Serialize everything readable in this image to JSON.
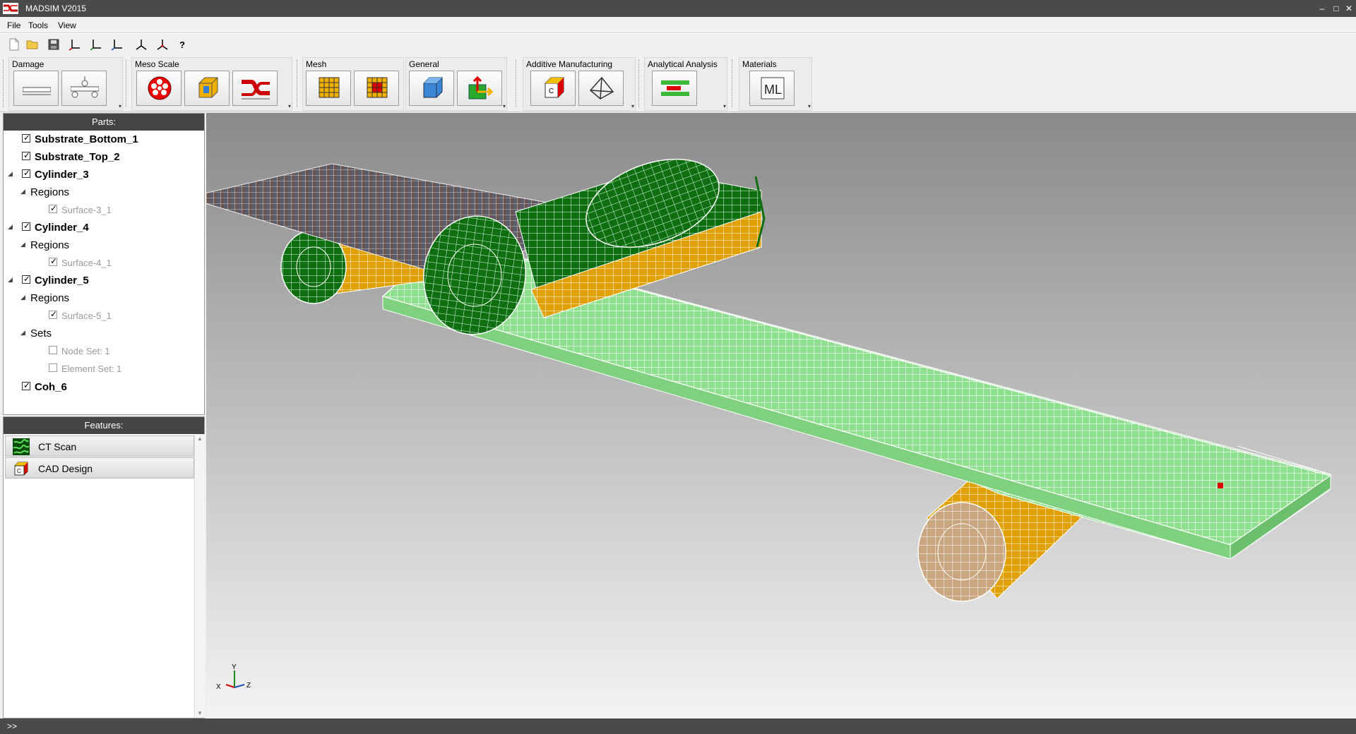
{
  "window": {
    "title": "MADSIM V2015",
    "minimize": "–",
    "maximize": "□",
    "close": "✕"
  },
  "menu": {
    "file": "File",
    "tools": "Tools",
    "view": "View"
  },
  "quickbar": {
    "help": "?"
  },
  "ribbon": {
    "damage": "Damage",
    "meso": "Meso Scale",
    "mesh": "Mesh",
    "general": "General",
    "additive": "Additive Manufacturing",
    "analytical": "Analytical Analysis",
    "materials": "Materials",
    "materials_icon_text": "ML",
    "additive_icon_text": "C"
  },
  "parts": {
    "header": "Parts:",
    "items": [
      {
        "label": "Substrate_Bottom_1",
        "checked": true
      },
      {
        "label": "Substrate_Top_2",
        "checked": true
      },
      {
        "label": "Cylinder_3",
        "checked": true
      },
      {
        "label": "Regions"
      },
      {
        "label": "Surface-3_1",
        "checked": true
      },
      {
        "label": "Cylinder_4",
        "checked": true
      },
      {
        "label": "Regions"
      },
      {
        "label": "Surface-4_1",
        "checked": true
      },
      {
        "label": "Cylinder_5",
        "checked": true
      },
      {
        "label": "Regions"
      },
      {
        "label": "Surface-5_1",
        "checked": true
      },
      {
        "label": "Sets"
      },
      {
        "label": "Node Set: 1",
        "checked": false
      },
      {
        "label": "Element Set: 1",
        "checked": false
      },
      {
        "label": "Coh_6",
        "checked": true
      }
    ]
  },
  "features": {
    "header": "Features:",
    "items": [
      {
        "label": "CT Scan"
      },
      {
        "label": "CAD Design"
      }
    ],
    "cad_icon_text": "C"
  },
  "viewport": {
    "colors": {
      "plate": "#8ee08e",
      "mesh_top": "#5a5e6a",
      "cyl_dark": "#0f6e0f",
      "cyl_orange": "#e0a000",
      "cyl_tan": "#c9a67f",
      "marker": "#e00000"
    },
    "triad": {
      "x": "X",
      "y": "Y",
      "z": "Z"
    }
  },
  "status": {
    "prompt": ">>"
  }
}
